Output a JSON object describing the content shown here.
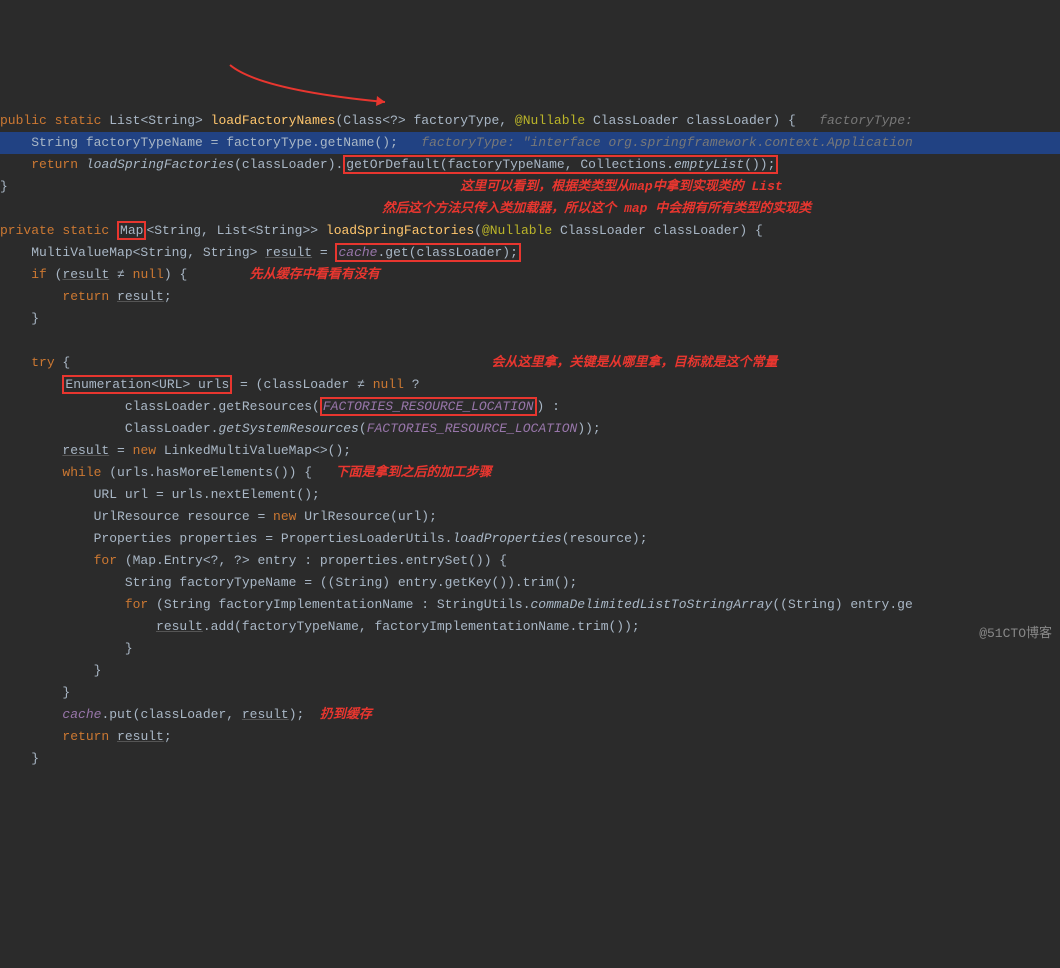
{
  "code": {
    "l1_public": "public",
    "l1_static": "static",
    "l1_type": " List<String> ",
    "l1_method": "loadFactoryNames",
    "l1_sig": "(Class<?> factoryType, ",
    "l1_anno": "@Nullable",
    "l1_sig2": " ClassLoader classLoader) {   ",
    "l1_hint": "factoryType:",
    "l2_a": "    String factoryTypeName = factoryType.getName();   ",
    "l2_hint": "factoryType: \"interface org.springframework.context.Application",
    "l3_a": "    ",
    "l3_return": "return",
    "l3_b": " ",
    "l3_call": "loadSpringFactories",
    "l3_c": "(classLoader).",
    "l3_box": "getOrDefault(factoryTypeName, Collections.",
    "l3_empty": "emptyList",
    "l3_end": "());",
    "l4": "}",
    "ann1": "这里可以看到，根据类类型从map中拿到实现类的 List",
    "ann2": "然后这个方法只传入类加载器，所以这个 map 中会拥有所有类型的实现类",
    "l6_private": "private",
    "l6_static": "static",
    "l6_sp": " ",
    "l6_map": "Map",
    "l6_gen": "<String, List<String>> ",
    "l6_method": "loadSpringFactories",
    "l6_sig": "(",
    "l6_anno": "@Nullable",
    "l6_sig2": " ClassLoader classLoader) {",
    "l7_a": "    MultiValueMap<String, String> ",
    "l7_result": "result",
    "l7_b": " = ",
    "l7_cache": "cache",
    "l7_get": ".get(classLoader);",
    "ann3": "先从缓存中看看有没有",
    "l8_a": "    ",
    "l8_if": "if",
    "l8_b": " (",
    "l8_result": "result",
    "l8_ne": " ≠ ",
    "l8_null": "null",
    "l8_c": ") {",
    "l9_a": "        ",
    "l9_return": "return",
    "l9_b": " ",
    "l9_result": "result",
    "l9_c": ";",
    "l10": "    }",
    "l12_a": "    ",
    "l12_try": "try",
    "l12_b": " {",
    "ann4": "会从这里拿，关键是从哪里拿，目标就是这个常量",
    "l13_a": "        ",
    "l13_box": "Enumeration<URL> urls",
    "l13_b": " = (classLoader ≠ ",
    "l13_null": "null",
    "l13_c": " ?",
    "l14_a": "                classLoader.getResources(",
    "l14_fac": "FACTORIES_RESOURCE_LOCATION",
    "l14_b": ") :",
    "l15_a": "                ClassLoader.",
    "l15_m": "getSystemResources",
    "l15_b": "(",
    "l15_fac": "FACTORIES_RESOURCE_LOCATION",
    "l15_c": "));",
    "l16_a": "        ",
    "l16_result": "result",
    "l16_b": " = ",
    "l16_new": "new",
    "l16_c": " LinkedMultiValueMap<>();",
    "l17_a": "        ",
    "l17_while": "while",
    "l17_b": " (urls.hasMoreElements()) {",
    "ann5": "下面是拿到之后的加工步骤",
    "l18": "            URL url = urls.nextElement();",
    "l19_a": "            UrlResource resource = ",
    "l19_new": "new",
    "l19_b": " UrlResource(url);",
    "l20_a": "            Properties properties = PropertiesLoaderUtils.",
    "l20_m": "loadProperties",
    "l20_b": "(resource);",
    "l21_a": "            ",
    "l21_for": "for",
    "l21_b": " (Map.Entry<?, ?> entry : properties.entrySet()) {",
    "l22": "                String factoryTypeName = ((String) entry.getKey()).trim();",
    "l23_a": "                ",
    "l23_for": "for",
    "l23_b": " (String factoryImplementationName : StringUtils.",
    "l23_m": "commaDelimitedListToStringArray",
    "l23_c": "((String) entry.ge",
    "l24_a": "                    ",
    "l24_result": "result",
    "l24_b": ".add(factoryTypeName, factoryImplementationName.trim());",
    "l25": "                }",
    "l26": "            }",
    "l27": "        }",
    "l28_a": "        ",
    "l28_cache": "cache",
    "l28_b": ".put(classLoader, ",
    "l28_result": "result",
    "l28_c": ");  ",
    "ann6": "扔到缓存",
    "l29_a": "        ",
    "l29_return": "return",
    "l29_b": " ",
    "l29_result": "result",
    "l29_c": ";",
    "l30": "    }"
  },
  "watermark": "@51CTO博客"
}
